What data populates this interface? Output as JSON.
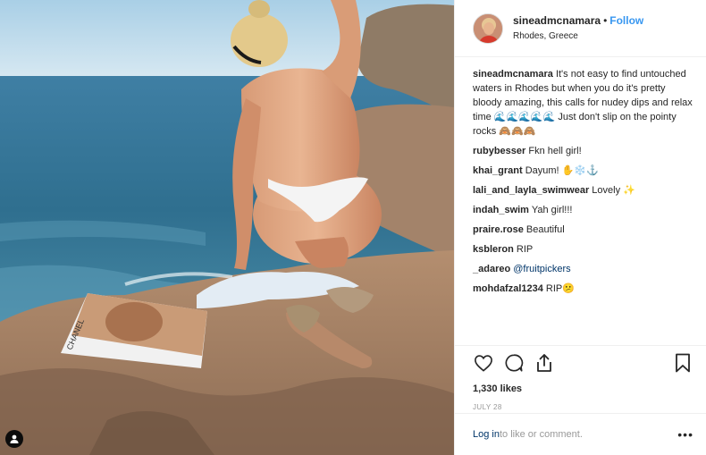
{
  "post": {
    "username": "sineadmcnamara",
    "follow_label": "Follow",
    "separator": "•",
    "location": "Rhodes, Greece",
    "magazine_label": "CHANEL"
  },
  "comments": [
    {
      "author": "sineadmcnamara",
      "text": " It's not easy to find untouched waters in Rhodes but when you do it's pretty bloody amazing, this calls for nudey dips and relax time 🌊🌊🌊🌊🌊 Just don't slip on the pointy rocks 🙈🙈🙈"
    },
    {
      "author": "rubybesser",
      "text": " Fkn hell girl!"
    },
    {
      "author": "khai_grant",
      "text": " Dayum! ✋❄️⚓"
    },
    {
      "author": "lali_and_layla_swimwear",
      "text": " Lovely ✨"
    },
    {
      "author": "indah_swim",
      "text": " Yah girl!!!"
    },
    {
      "author": "praire.rose",
      "text": " Beautiful"
    },
    {
      "author": "ksbleron",
      "text": " RIP"
    },
    {
      "author": "_adareo",
      "text": " ",
      "mention": "@fruitpickers"
    },
    {
      "author": "mohdafzal1234",
      "text": " RIP😕"
    }
  ],
  "stats": {
    "likes": "1,330 likes",
    "date": "JULY 28"
  },
  "footer": {
    "login_label": "Log in",
    "login_suffix": " to like or comment.",
    "more_label": "•••"
  },
  "icons": {
    "like": "heart-icon",
    "comment": "comment-bubble-icon",
    "share": "share-icon",
    "save": "bookmark-icon",
    "tag": "user-tag-icon"
  },
  "colors": {
    "link_blue": "#3897f0",
    "mention": "#003569",
    "muted": "#999999",
    "border": "#efefef"
  }
}
